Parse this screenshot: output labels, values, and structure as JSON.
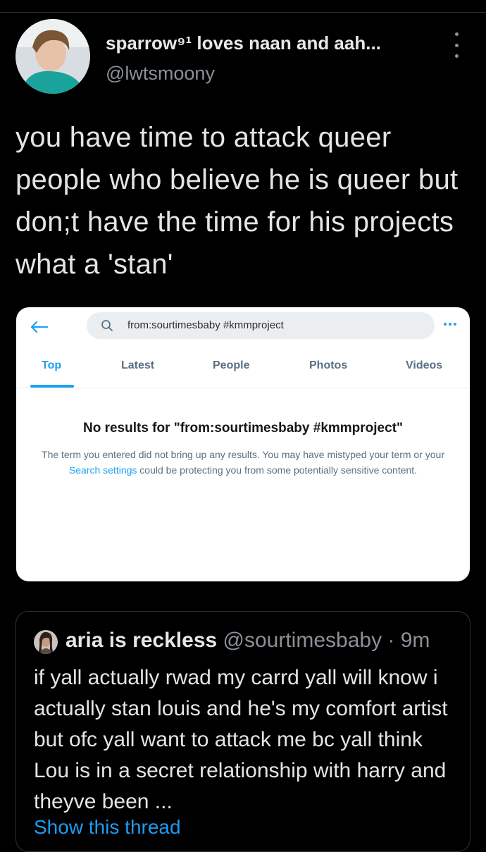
{
  "tweet": {
    "display_name": "sparrow⁹¹ loves naan and aah...",
    "handle": "@lwtsmoony",
    "text": "you have time to attack queer people who believe he is queer but don;t have the time for his projects what a 'stan'"
  },
  "screenshot_card": {
    "search_query": "from:sourtimesbaby #kmmproject",
    "tabs": [
      "Top",
      "Latest",
      "People",
      "Photos",
      "Videos"
    ],
    "active_tab": "Top",
    "no_results_title": "No results for \"from:sourtimesbaby #kmmproject\"",
    "no_results_body_1": "The term you entered did not bring up any results. You may have mistyped your term or your ",
    "no_results_link": "Search settings",
    "no_results_body_2": " could be protecting you from some potentially sensitive content.",
    "accent_color": "#1da1f2"
  },
  "quoted_tweet": {
    "display_name": "aria is reckless",
    "handle": "@sourtimesbaby",
    "separator": " · ",
    "time": "9m",
    "text": "if yall actually rwad my carrd yall will know i actually stan louis and he's my comfort artist but ofc yall want to attack me bc yall think Lou is in a secret relationship with harry and theyve been ...",
    "show_thread": "Show this thread"
  }
}
